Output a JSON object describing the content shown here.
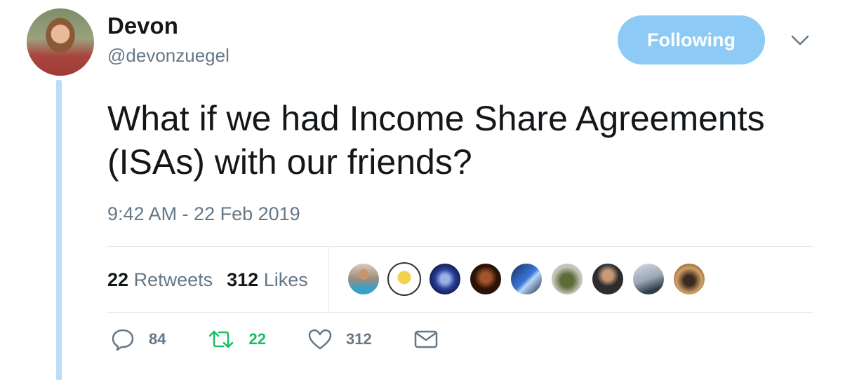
{
  "author": {
    "name": "Devon",
    "handle": "@devonzuegel"
  },
  "follow_button": {
    "label": "Following"
  },
  "tweet": {
    "text": "What if we had Income Share Agreements (ISAs) with our friends?",
    "timestamp": "9:42 AM - 22 Feb 2019"
  },
  "stats": {
    "retweets_count": "22",
    "retweets_label": "Retweets",
    "likes_count": "312",
    "likes_label": "Likes"
  },
  "likers": [
    {
      "icon": "avatar-person-blue"
    },
    {
      "icon": "avatar-dhjinta-logo"
    },
    {
      "icon": "avatar-geometric-pattern"
    },
    {
      "icon": "avatar-person-dark"
    },
    {
      "icon": "avatar-person-blue-lit"
    },
    {
      "icon": "avatar-bird"
    },
    {
      "icon": "avatar-person-suit"
    },
    {
      "icon": "avatar-landscape"
    },
    {
      "icon": "avatar-person-sunset"
    }
  ],
  "actions": {
    "reply_count": "84",
    "retweet_count": "22",
    "like_count": "312"
  },
  "colors": {
    "accent": "#8ecaf6",
    "retweet_green": "#17bf63",
    "muted": "#657786",
    "thread_line": "#bfdcf5"
  }
}
